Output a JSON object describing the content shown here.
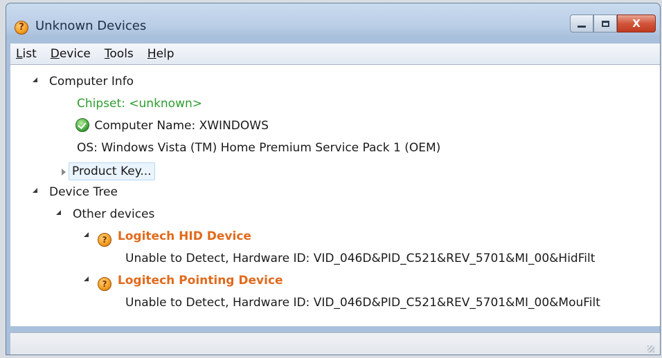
{
  "window": {
    "title": "Unknown Devices",
    "close_glyph": "X"
  },
  "menu": [
    {
      "label": "List",
      "accel": "L",
      "rest": "ist"
    },
    {
      "label": "Device",
      "accel": "D",
      "rest": "evice"
    },
    {
      "label": "Tools",
      "accel": "T",
      "rest": "ools"
    },
    {
      "label": "Help",
      "accel": "H",
      "rest": "elp"
    }
  ],
  "tree": {
    "computer_info": {
      "label": "Computer Info",
      "chipset": "Chipset: <unknown>",
      "computer_name": "Computer Name: XWINDOWS",
      "os": "OS: Windows Vista (TM) Home Premium Service Pack 1 (OEM)",
      "product_key": "Product Key..."
    },
    "device_tree": {
      "label": "Device Tree",
      "other_devices": {
        "label": "Other devices",
        "devices": [
          {
            "name": "Logitech HID Device",
            "detail": "Unable to Detect, Hardware ID: VID_046D&PID_C521&REV_5701&MI_00&HidFilt"
          },
          {
            "name": "Logitech Pointing Device",
            "detail": "Unable to Detect, Hardware ID: VID_046D&PID_C521&REV_5701&MI_00&MouFilt"
          }
        ]
      }
    }
  },
  "icons": {
    "app": "warning-question-icon",
    "computer_name": "green-check-icon",
    "device": "warning-question-icon"
  },
  "colors": {
    "chipset_text": "#2e9c2e",
    "device_text": "#e26a1c",
    "selection": "#eaf4fd"
  }
}
